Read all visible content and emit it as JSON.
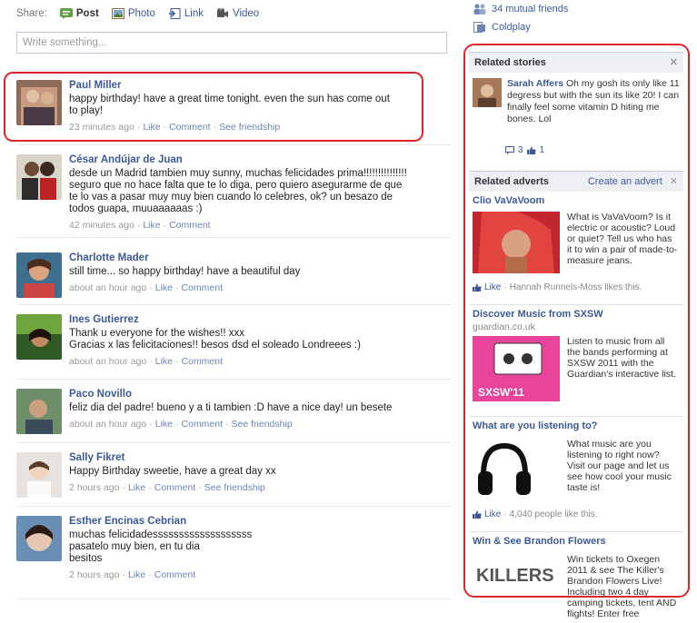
{
  "share": {
    "label": "Share:",
    "items": [
      {
        "label": "Post",
        "icon": "post-icon"
      },
      {
        "label": "Photo",
        "icon": "photo-icon"
      },
      {
        "label": "Link",
        "icon": "link-icon"
      },
      {
        "label": "Video",
        "icon": "video-icon"
      }
    ],
    "placeholder": "Write something..."
  },
  "top_right": {
    "mutual": "34 mutual friends",
    "page": "Coldplay"
  },
  "posts": [
    {
      "author": "Paul Miller",
      "message": "happy birthday! have a great time tonight. even the sun has come out\nto play!",
      "time": "23 minutes ago",
      "like": "Like",
      "comment": "Comment",
      "extra": "See friendship"
    },
    {
      "author": "César Andújar de Juan",
      "message": "desde un Madrid tambien muy sunny, muchas felicidades prima!!!!!!!!!!!!!!!\nseguro que no hace falta que te lo diga, pero quiero asegurarme de que\nte lo vas a pasar muy muy bien cuando lo celebres, ok? un besazo de\ntodos guapa, muuaaaaaas :)",
      "time": "42 minutes ago",
      "like": "Like",
      "comment": "Comment",
      "extra": ""
    },
    {
      "author": "Charlotte Mader",
      "message": "still time... so happy birthday! have a beautiful day",
      "time": "about an hour ago",
      "like": "Like",
      "comment": "Comment",
      "extra": ""
    },
    {
      "author": "Ines Gutierrez",
      "message": "Thank u everyone for the wishes!! xxx\nGracias x las felicitaciones!! besos dsd el soleado Londreees :)",
      "time": "about an hour ago",
      "like": "Like",
      "comment": "Comment",
      "extra": ""
    },
    {
      "author": "Paco Novillo",
      "message": "feliz dia del padre! bueno y a ti tambien :D have a nice day! un besete",
      "time": "about an hour ago",
      "like": "Like",
      "comment": "Comment",
      "extra": "See friendship"
    },
    {
      "author": "Sally Fikret",
      "message": "Happy Birthday sweetie, have a great day xx",
      "time": "2 hours ago",
      "like": "Like",
      "comment": "Comment",
      "extra": "See friendship"
    },
    {
      "author": "Esther Encinas Cebrian",
      "message": "muchas felicidadesssssssssssssssssss\npasatelo muy bien, en tu dia\nbesitos",
      "time": "2 hours ago",
      "like": "Like",
      "comment": "Comment",
      "extra": ""
    }
  ],
  "related_stories": {
    "header": "Related stories",
    "author": "Sarah Affers",
    "text": "Oh my gosh its only like 11 degress but with the sun its like 20! I can finally feel some vitamin D hiting me bones. Lol",
    "comments": "3",
    "likes": "1"
  },
  "related_adverts": {
    "header": "Related adverts",
    "create": "Create an advert",
    "ads": [
      {
        "title": "Clio VaVaVoom",
        "sub": "",
        "text": "What is VaVaVoom? Is it electric or acoustic? Loud or quiet? Tell us who has it to win a pair of made-to-measure jeans.",
        "like": "Like",
        "like_text": "Hannah Runnels-Moss likes this."
      },
      {
        "title": "Discover Music from SXSW",
        "sub": "guardian.co.uk",
        "text": "Listen to music from all the bands performing at SXSW 2011 with the Guardian's interactive list.",
        "like": "",
        "like_text": "",
        "img_label": "SXSW'11"
      },
      {
        "title": "What are you listening to?",
        "sub": "",
        "text": "What music are you listening to right now? Visit our page and let us see how cool your music taste is!",
        "like": "Like",
        "like_text": "4,040 people like this."
      },
      {
        "title": "Win & See Brandon Flowers",
        "sub": "",
        "text": "Win tickets to Oxegen 2011 & see The Killer's Brandon Flowers Live! Including two 4 day camping tickets, tent AND flights! Enter free",
        "like": "",
        "like_text": "",
        "img_label": "KILLERS"
      }
    ]
  },
  "colors": {
    "link": "#3b5998",
    "highlight": "#e0242b",
    "header_bg": "#edeff4"
  }
}
